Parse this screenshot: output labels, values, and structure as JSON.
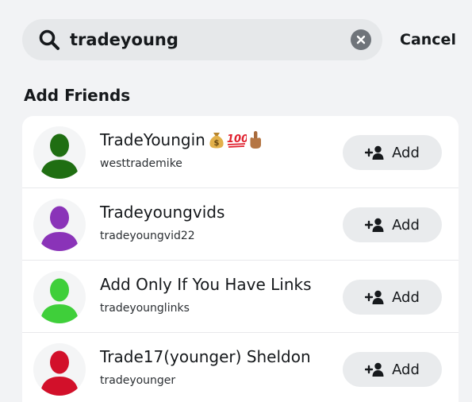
{
  "search": {
    "value": "tradeyoung",
    "cancel_label": "Cancel"
  },
  "section": {
    "title": "Add Friends"
  },
  "results": [
    {
      "display_name": "TradeYoungin",
      "emojis": [
        "money-bag-icon",
        "hundred-points-icon",
        "middle-finger-icon"
      ],
      "username": "westtrademike",
      "avatar_color": "#1f6e12",
      "add_label": "Add"
    },
    {
      "display_name": "Tradeyoungvids",
      "emojis": [],
      "username": "tradeyoungvid22",
      "avatar_color": "#8a33b8",
      "add_label": "Add"
    },
    {
      "display_name": "Add Only If You Have Links",
      "emojis": [],
      "username": "tradeyounglinks",
      "avatar_color": "#3fcf3a",
      "add_label": "Add"
    },
    {
      "display_name": "Trade17(younger) Sheldon",
      "emojis": [],
      "username": "tradeyounger",
      "avatar_color": "#d2102a",
      "add_label": "Add"
    }
  ]
}
